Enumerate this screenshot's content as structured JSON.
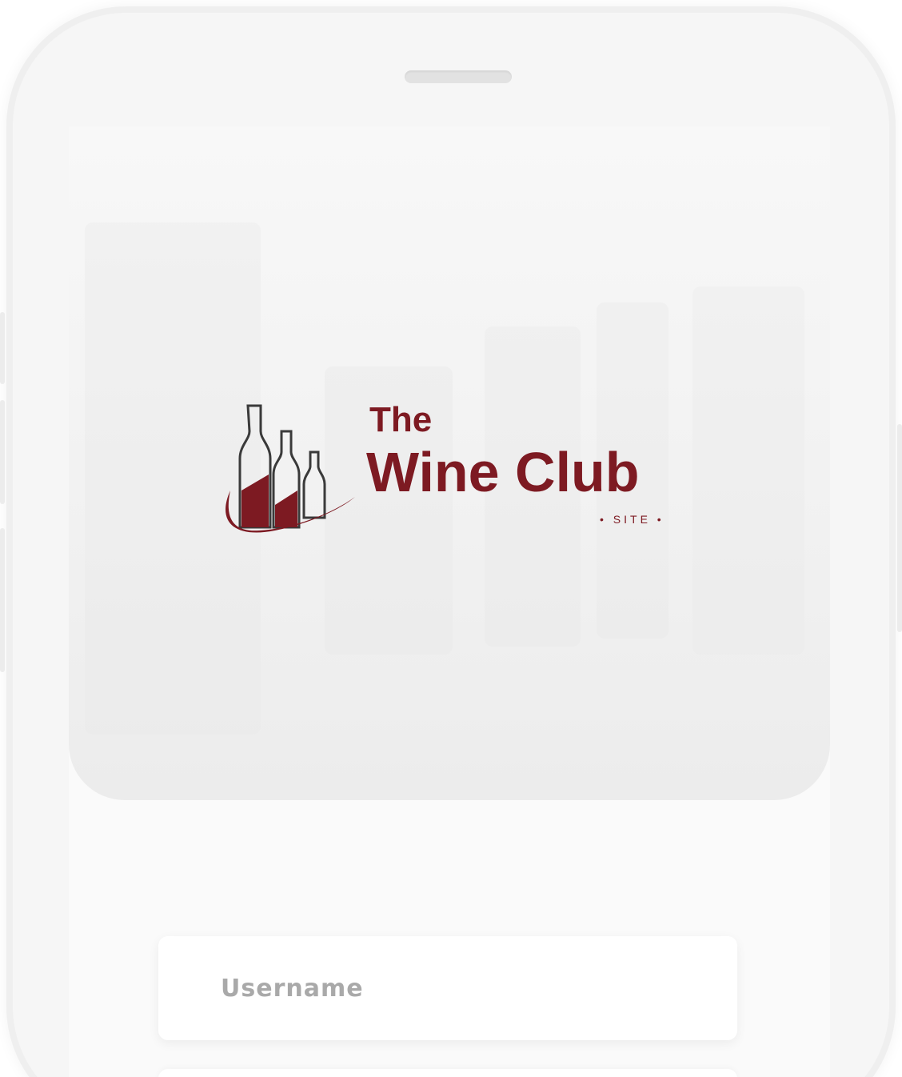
{
  "brand": {
    "line1": "The",
    "line2": "Wine Club",
    "line3": "• SITE •",
    "accent_color": "#7d1a22"
  },
  "login": {
    "username_placeholder": "Username",
    "username_value": ""
  },
  "icons": {
    "logo": "wine-bottles-logo-icon"
  }
}
